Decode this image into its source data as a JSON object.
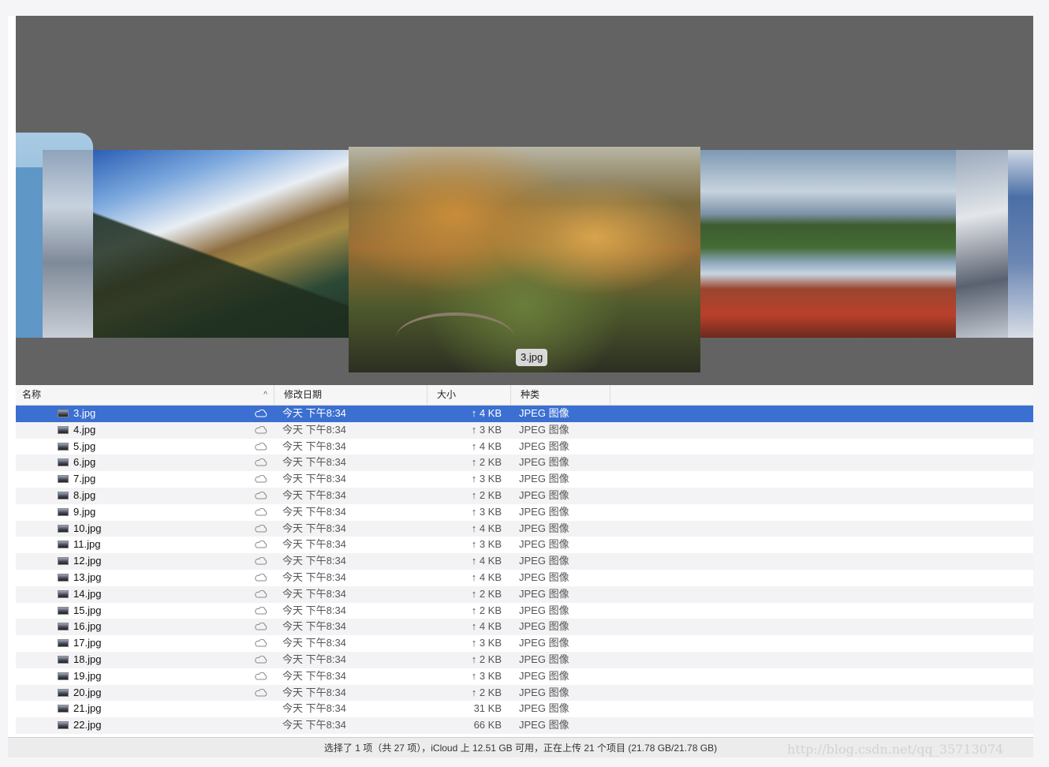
{
  "coverflow": {
    "caption": "3.jpg",
    "images": [
      "snow-tree",
      "mountain",
      "forest-bridge",
      "river-rocks",
      "snow-peak",
      "edge"
    ]
  },
  "columns": {
    "name": "名称",
    "date": "修改日期",
    "size": "大小",
    "kind": "种类",
    "sort_indicator": "^"
  },
  "rows": [
    {
      "name": "3.jpg",
      "date": "今天 下午8:34",
      "size": "↑ 4 KB",
      "kind": "JPEG 图像",
      "cloud": true,
      "selected": true
    },
    {
      "name": "4.jpg",
      "date": "今天 下午8:34",
      "size": "↑ 3 KB",
      "kind": "JPEG 图像",
      "cloud": true
    },
    {
      "name": "5.jpg",
      "date": "今天 下午8:34",
      "size": "↑ 4 KB",
      "kind": "JPEG 图像",
      "cloud": true
    },
    {
      "name": "6.jpg",
      "date": "今天 下午8:34",
      "size": "↑ 2 KB",
      "kind": "JPEG 图像",
      "cloud": true
    },
    {
      "name": "7.jpg",
      "date": "今天 下午8:34",
      "size": "↑ 3 KB",
      "kind": "JPEG 图像",
      "cloud": true
    },
    {
      "name": "8.jpg",
      "date": "今天 下午8:34",
      "size": "↑ 2 KB",
      "kind": "JPEG 图像",
      "cloud": true
    },
    {
      "name": "9.jpg",
      "date": "今天 下午8:34",
      "size": "↑ 3 KB",
      "kind": "JPEG 图像",
      "cloud": true
    },
    {
      "name": "10.jpg",
      "date": "今天 下午8:34",
      "size": "↑ 4 KB",
      "kind": "JPEG 图像",
      "cloud": true
    },
    {
      "name": "11.jpg",
      "date": "今天 下午8:34",
      "size": "↑ 3 KB",
      "kind": "JPEG 图像",
      "cloud": true
    },
    {
      "name": "12.jpg",
      "date": "今天 下午8:34",
      "size": "↑ 4 KB",
      "kind": "JPEG 图像",
      "cloud": true
    },
    {
      "name": "13.jpg",
      "date": "今天 下午8:34",
      "size": "↑ 4 KB",
      "kind": "JPEG 图像",
      "cloud": true
    },
    {
      "name": "14.jpg",
      "date": "今天 下午8:34",
      "size": "↑ 2 KB",
      "kind": "JPEG 图像",
      "cloud": true
    },
    {
      "name": "15.jpg",
      "date": "今天 下午8:34",
      "size": "↑ 2 KB",
      "kind": "JPEG 图像",
      "cloud": true
    },
    {
      "name": "16.jpg",
      "date": "今天 下午8:34",
      "size": "↑ 4 KB",
      "kind": "JPEG 图像",
      "cloud": true
    },
    {
      "name": "17.jpg",
      "date": "今天 下午8:34",
      "size": "↑ 3 KB",
      "kind": "JPEG 图像",
      "cloud": true
    },
    {
      "name": "18.jpg",
      "date": "今天 下午8:34",
      "size": "↑ 2 KB",
      "kind": "JPEG 图像",
      "cloud": true
    },
    {
      "name": "19.jpg",
      "date": "今天 下午8:34",
      "size": "↑ 3 KB",
      "kind": "JPEG 图像",
      "cloud": true
    },
    {
      "name": "20.jpg",
      "date": "今天 下午8:34",
      "size": "↑ 2 KB",
      "kind": "JPEG 图像",
      "cloud": true
    },
    {
      "name": "21.jpg",
      "date": "今天 下午8:34",
      "size": "31 KB",
      "kind": "JPEG 图像",
      "cloud": false
    },
    {
      "name": "22.jpg",
      "date": "今天 下午8:34",
      "size": "66 KB",
      "kind": "JPEG 图像",
      "cloud": false
    }
  ],
  "status": "选择了 1 项（共 27 项），iCloud 上 12.51 GB 可用，正在上传 21 个项目 (21.78 GB/21.78 GB)",
  "watermark": "http://blog.csdn.net/qq_35713074",
  "colors": {
    "selection": "#3b6fd1",
    "coverflow_bg": "#636363"
  }
}
